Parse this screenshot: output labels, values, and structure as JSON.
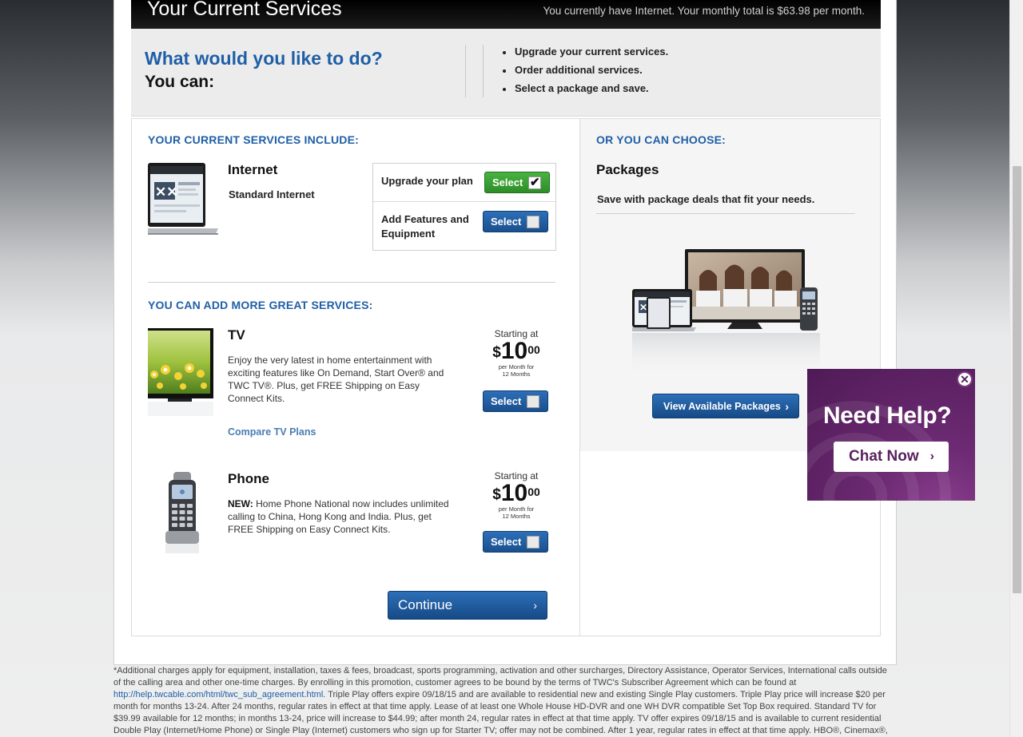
{
  "header": {
    "title": "Your Current Services",
    "summary": "You currently have Internet. Your monthly total is $63.98 per month."
  },
  "question": {
    "line1": "What would you like to do?",
    "line2": "You can:",
    "options": [
      "Upgrade your current services.",
      "Order additional services.",
      "Select a package and save."
    ]
  },
  "current": {
    "heading": "YOUR CURRENT SERVICES INCLUDE:",
    "service_name": "Internet",
    "plan_name": "Standard Internet",
    "upgrade_label": "Upgrade your plan",
    "features_label": "Add Features and Equipment",
    "select_label": "Select"
  },
  "add_more": {
    "heading": "YOU CAN ADD MORE GREAT SERVICES:",
    "tv": {
      "name": "TV",
      "desc": "Enjoy the very latest in home entertainment with exciting features like On Demand, Start Over® and TWC TV®. Plus, get FREE Shipping on Easy Connect Kits.",
      "link": "Compare TV Plans",
      "starting": "Starting at",
      "dollar": "$",
      "amount": "10",
      "cents": "00",
      "per1": "per Month for",
      "per2": "12 Months"
    },
    "phone": {
      "name": "Phone",
      "new_label": "NEW:",
      "desc": "Home Phone National now includes unlimited calling to China, Hong Kong and India. Plus, get FREE Shipping on Easy Connect Kits.",
      "starting": "Starting at",
      "dollar": "$",
      "amount": "10",
      "cents": "00",
      "per1": "per Month for",
      "per2": "12 Months"
    },
    "continue_label": "Continue"
  },
  "packages": {
    "heading": "OR YOU CAN CHOOSE:",
    "title": "Packages",
    "desc": "Save with package deals that fit your needs.",
    "button": "View Available Packages"
  },
  "chat_ad": {
    "headline": "Need Help?",
    "button": "Chat Now"
  },
  "footnote": {
    "part1": "*Additional charges apply for equipment, installation, taxes & fees, broadcast, sports programming, activation and other surcharges, Directory Assistance, Operator Services, International calls outside of the calling area and other one-time charges. By enrolling in this promotion, customer agrees to be bound by the terms of TWC's Subscriber Agreement which can be found at",
    "link": "http://help.twcable.com/html/twc_sub_agreement.html",
    "part2": ". Triple Play offers expire 09/18/15 and are available to residential new and existing Single Play customers. Triple Play price will increase $20 per month for months 13-24. After 24 months, regular rates in effect at that time apply. Lease of at least one Whole House HD-DVR and one WH DVR compatible Set Top Box required. Standard TV for $39.99 available for 12 months; in months 13-24, price will increase to $44.99; after month 24, regular rates in effect at that time apply. TV offer expires 09/18/15 and is available to current residential Double Play (Internet/Home Phone) or Single Play (Internet) customers who sign up for Starter TV; offer may not be combined. After 1 year, regular rates in effect at that time apply. HBO®, Cinemax®,"
  },
  "colors": {
    "accent_blue": "#1f5fa7",
    "button_green": "#2d8d28",
    "ad_purple": "#6c2a72"
  }
}
